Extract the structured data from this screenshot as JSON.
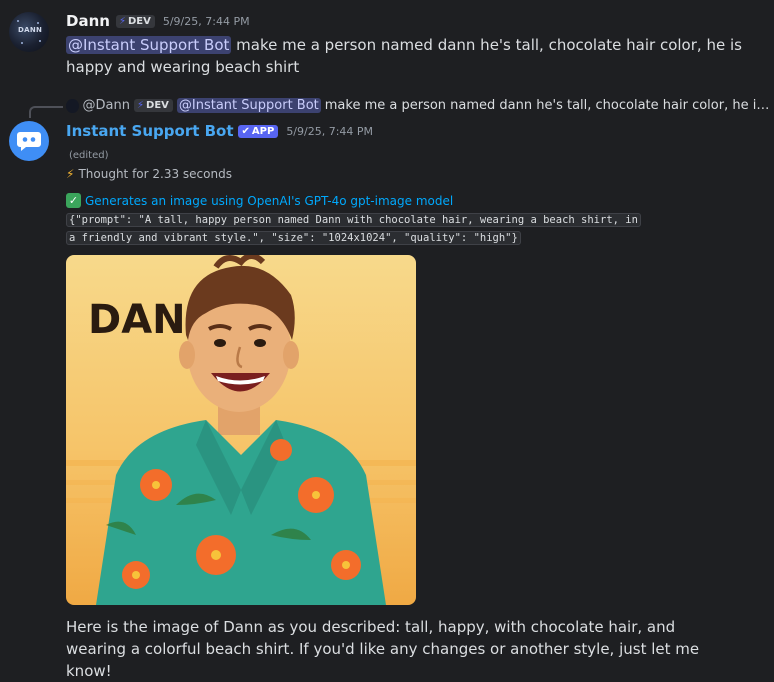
{
  "message1": {
    "author": "Dann",
    "badge": "DEV",
    "timestamp": "5/9/25, 7:44 PM",
    "mention": "@Instant Support Bot",
    "text": " make me a person named dann he's tall,  chocolate hair color, he is happy and wearing beach shirt"
  },
  "reply": {
    "author": "@Dann",
    "badge": "DEV",
    "mention": "@Instant Support Bot",
    "text": "make me a person named dann he's tall,  chocolate hair color, he is happy ..."
  },
  "message2": {
    "author": "Instant Support Bot",
    "badge": "APP",
    "timestamp": "5/9/25, 7:44 PM",
    "edited": "(edited)",
    "thought": "Thought for 2.33 seconds",
    "tool_label": "Generates an image using OpenAI's GPT-4o gpt-image model",
    "code_line1": "{\"prompt\": \"A tall, happy person named Dann with chocolate hair, wearing a beach shirt, in",
    "code_line2": "a friendly and vibrant style.\", \"size\": \"1024x1024\", \"quality\": \"high\"}",
    "image_caption_text": "DANN",
    "final_text": "Here is the image of Dann as you described: tall, happy, with chocolate hair, and wearing a colorful beach shirt. If you'd like any changes or another style, just let me know!"
  },
  "colors": {
    "background": "#1e1f22",
    "mention_bg": "#3c4270",
    "bot_name": "#49a7f1",
    "link": "#00a8fc",
    "app_badge": "#5865f2"
  }
}
